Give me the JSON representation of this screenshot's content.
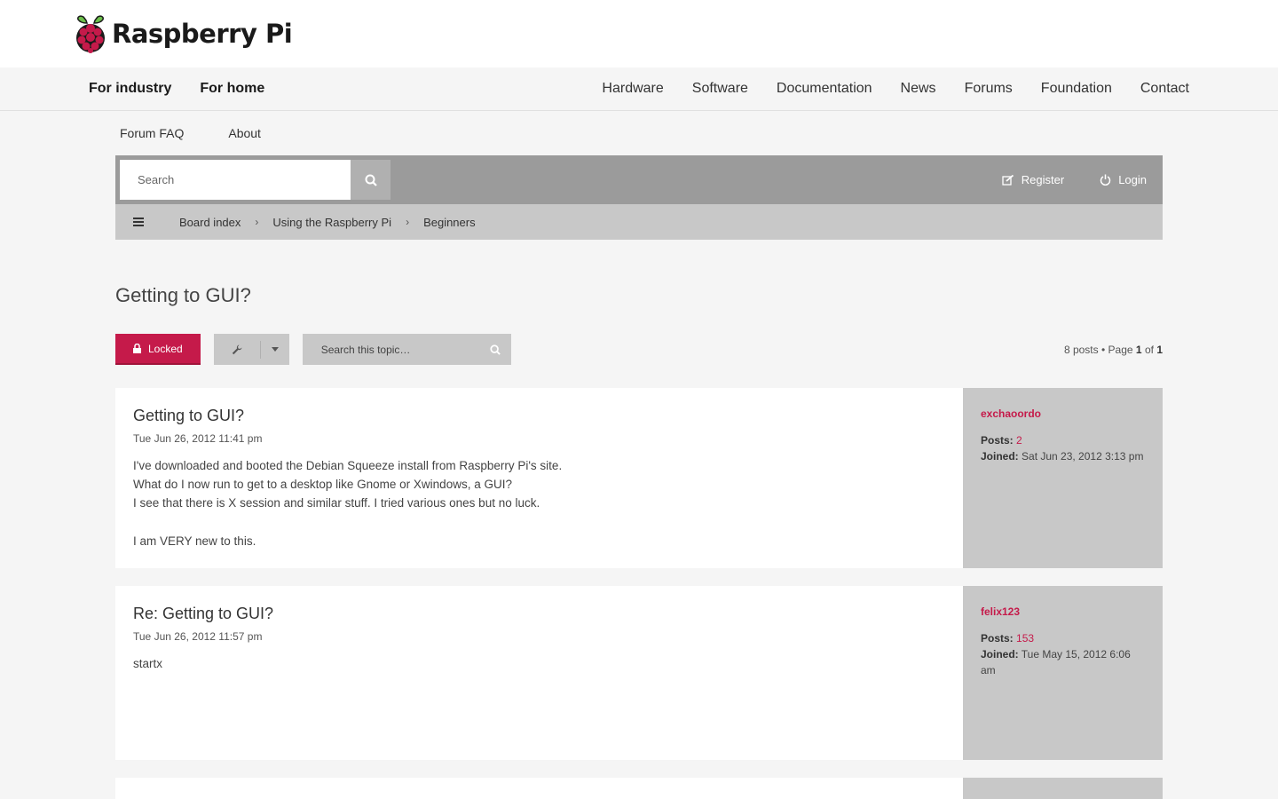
{
  "brand": {
    "name": "Raspberry Pi"
  },
  "main_nav": {
    "left": [
      "For industry",
      "For home"
    ],
    "right": [
      "Hardware",
      "Software",
      "Documentation",
      "News",
      "Forums",
      "Foundation",
      "Contact"
    ]
  },
  "forum_links": [
    "Forum FAQ",
    "About"
  ],
  "toolbar": {
    "search_placeholder": "Search",
    "register": "Register",
    "login": "Login"
  },
  "breadcrumbs": [
    "Board index",
    "Using the Raspberry Pi",
    "Beginners"
  ],
  "topic": {
    "title": "Getting to GUI?",
    "locked_label": "Locked",
    "search_placeholder": "Search this topic…",
    "pagination": {
      "posts": "8 posts",
      "sep": "•",
      "page_word": "Page",
      "current": "1",
      "of": "of",
      "total": "1"
    }
  },
  "colors": {
    "accent": "#c51a4a",
    "toolbar": "#9b9b9b",
    "breadcrumb": "#c8c8c8"
  },
  "posts": [
    {
      "title": "Getting to GUI?",
      "date": "Tue Jun 26, 2012 11:41 pm",
      "lines": [
        "I've downloaded and booted the Debian Squeeze install from Raspberry Pi's site.",
        "What do I now run to get to a desktop like Gnome or Xwindows, a GUI?",
        "I see that there is X session and similar stuff. I tried various ones but no luck.",
        "",
        "I am VERY new to this."
      ],
      "author": "exchaoordo",
      "posts_label": "Posts:",
      "posts_count": "2",
      "joined_label": "Joined:",
      "joined": "Sat Jun 23, 2012 3:13 pm"
    },
    {
      "title": "Re: Getting to GUI?",
      "date": "Tue Jun 26, 2012 11:57 pm",
      "lines": [
        "startx"
      ],
      "author": "felix123",
      "posts_label": "Posts:",
      "posts_count": "153",
      "joined_label": "Joined:",
      "joined": "Tue May 15, 2012 6:06 am"
    }
  ]
}
